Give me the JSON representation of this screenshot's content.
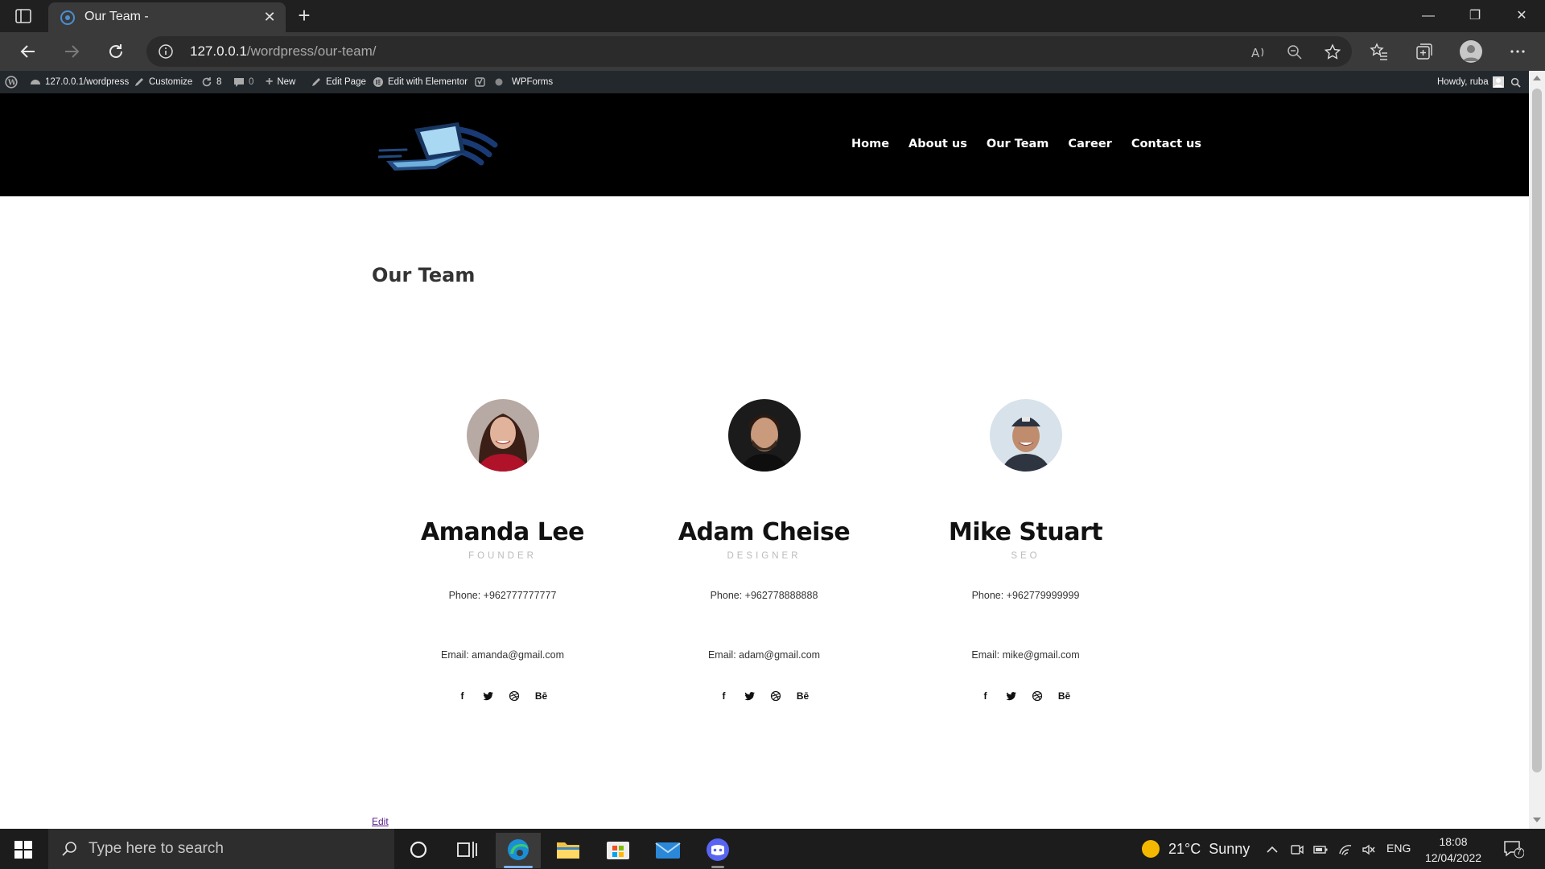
{
  "browser": {
    "tab_title": "Our Team -",
    "url_host": "127.0.0.1",
    "url_path": "/wordpress/our-team/"
  },
  "wp_admin_bar": {
    "site": "127.0.0.1/wordpress",
    "customize": "Customize",
    "updates": "8",
    "comments": "0",
    "new": "New",
    "edit_page": "Edit Page",
    "edit_elementor": "Edit with Elementor",
    "wpforms": "WPForms",
    "howdy": "Howdy, ruba"
  },
  "site": {
    "menu": [
      "Home",
      "About us",
      "Our Team",
      "Career",
      "Contact us"
    ]
  },
  "page": {
    "title": "Our Team",
    "edit_link": "Edit"
  },
  "team": [
    {
      "name": "Amanda Lee",
      "role": "FOUNDER",
      "phone": "Phone: +962777777777",
      "email": "Email: amanda@gmail.com"
    },
    {
      "name": "Adam Cheise",
      "role": "DESIGNER",
      "phone": "Phone: +962778888888",
      "email": "Email: adam@gmail.com"
    },
    {
      "name": "Mike Stuart",
      "role": "SEO",
      "phone": "Phone: +962779999999",
      "email": "Email: mike@gmail.com"
    }
  ],
  "social_icons": [
    "facebook-icon",
    "twitter-icon",
    "dribbble-icon",
    "behance-icon"
  ],
  "behance_label": "Bē",
  "taskbar": {
    "search_placeholder": "Type here to search",
    "weather": "21°C  Sunny",
    "language": "ENG",
    "time": "18:08",
    "date": "12/04/2022",
    "notification_count": "7"
  }
}
